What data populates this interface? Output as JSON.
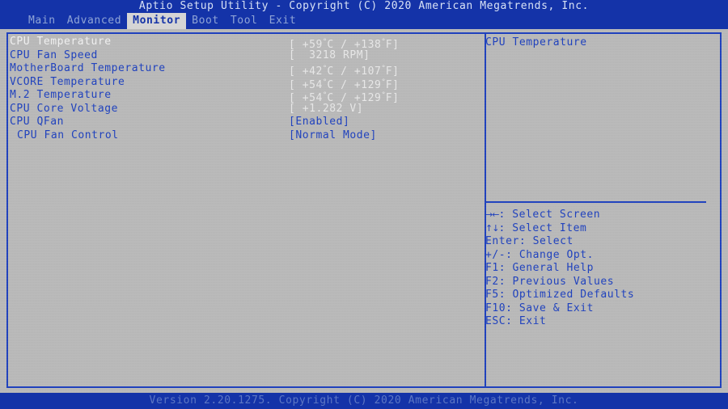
{
  "title_bar": {
    "text": "Aptio Setup Utility - Copyright (C) 2020 American Megatrends, Inc."
  },
  "menu_bar": {
    "items": [
      {
        "label": "Main",
        "active": false
      },
      {
        "label": "Advanced",
        "active": false
      },
      {
        "label": "Monitor",
        "active": true
      },
      {
        "label": "Boot",
        "active": false
      },
      {
        "label": "Tool",
        "active": false
      },
      {
        "label": "Exit",
        "active": false
      }
    ]
  },
  "settings": {
    "rows": [
      {
        "label": "CPU Temperature",
        "value": "[ +59°C / +138°F]",
        "value_prefix": "[ +59",
        "value_mid": "C / +138",
        "value_suffix": "F]",
        "kind": "readonly",
        "selected": true,
        "indent": false
      },
      {
        "label": "CPU Fan Speed",
        "value": "[  3218 RPM]",
        "kind": "readonly",
        "selected": false,
        "indent": false
      },
      {
        "label": "MotherBoard Temperature",
        "value": "[ +42°C / +107°F]",
        "value_prefix": "[ +42",
        "value_mid": "C / +107",
        "value_suffix": "F]",
        "kind": "readonly",
        "selected": false,
        "indent": false
      },
      {
        "label": "VCORE Temperature",
        "value": "[ +54°C / +129°F]",
        "value_prefix": "[ +54",
        "value_mid": "C / +129",
        "value_suffix": "F]",
        "kind": "readonly",
        "selected": false,
        "indent": false
      },
      {
        "label": "M.2 Temperature",
        "value": "[ +54°C / +129°F]",
        "value_prefix": "[ +54",
        "value_mid": "C / +129",
        "value_suffix": "F]",
        "kind": "readonly",
        "selected": false,
        "indent": false
      },
      {
        "label": "CPU Core Voltage",
        "value": "[ +1.282 V]",
        "kind": "readonly",
        "selected": false,
        "indent": false
      },
      {
        "label": "CPU QFan",
        "value": "[Enabled]",
        "kind": "option",
        "selected": false,
        "indent": false
      },
      {
        "label": "CPU Fan Control",
        "value": "[Normal Mode]",
        "kind": "option",
        "selected": false,
        "indent": true
      }
    ]
  },
  "help_panel": {
    "title": "CPU Temperature",
    "keys": [
      {
        "glyph": "→←",
        "text": ": Select Screen"
      },
      {
        "glyph": "↑↓",
        "text": ": Select Item"
      },
      {
        "glyph": "",
        "text": "Enter: Select"
      },
      {
        "glyph": "",
        "text": "+/-: Change Opt."
      },
      {
        "glyph": "",
        "text": "F1: General Help"
      },
      {
        "glyph": "",
        "text": "F2: Previous Values"
      },
      {
        "glyph": "",
        "text": "F5: Optimized Defaults"
      },
      {
        "glyph": "",
        "text": "F10: Save & Exit"
      },
      {
        "glyph": "",
        "text": "ESC: Exit"
      }
    ]
  },
  "footer_bar": {
    "text": "Version 2.20.1275. Copyright (C) 2020 American Megatrends, Inc."
  }
}
